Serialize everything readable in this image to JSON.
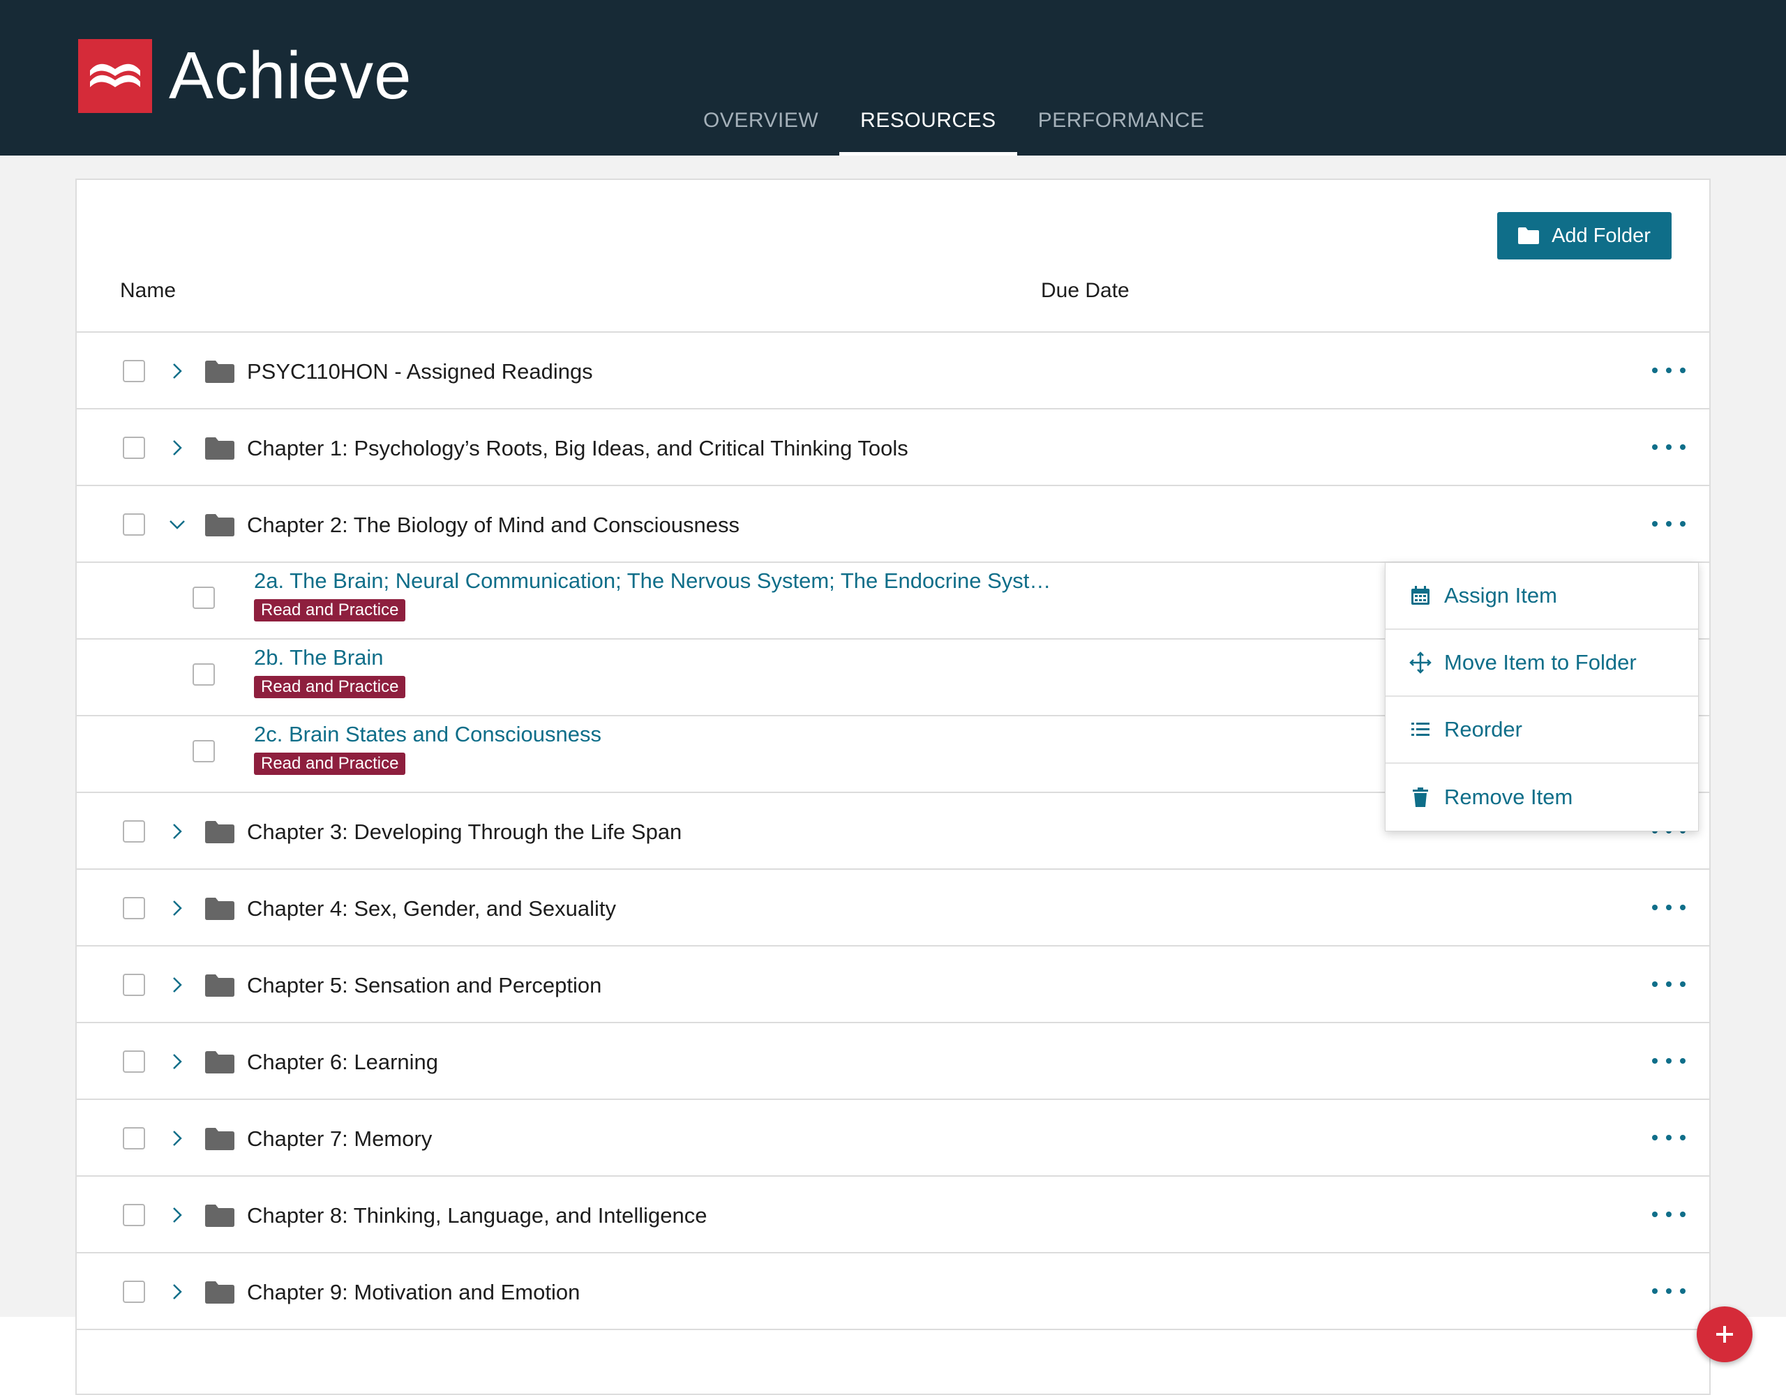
{
  "brand": {
    "name": "Achieve",
    "logo_color": "#d52b39"
  },
  "nav": {
    "tabs": [
      {
        "label": "OVERVIEW",
        "active": false
      },
      {
        "label": "RESOURCES",
        "active": true
      },
      {
        "label": "PERFORMANCE",
        "active": false
      }
    ]
  },
  "toolbar": {
    "add_folder_label": "Add Folder",
    "add_folder_icon": "folder-icon"
  },
  "table": {
    "columns": [
      "Name",
      "Due Date"
    ],
    "rows": [
      {
        "type": "folder",
        "title": "PSYC110HON - Assigned Readings",
        "expanded": false
      },
      {
        "type": "folder",
        "title": "Chapter 1: Psychology’s Roots, Big Ideas, and Critical Thinking Tools",
        "expanded": false
      },
      {
        "type": "folder",
        "title": "Chapter 2: The Biology of Mind and Consciousness",
        "expanded": true
      },
      {
        "type": "item",
        "title": "2a. The Brain; Neural Communication; The Nervous System; The Endocrine Syst…",
        "badge": "Read and Practice"
      },
      {
        "type": "item",
        "title": "2b. The Brain",
        "badge": "Read and Practice"
      },
      {
        "type": "item",
        "title": "2c. Brain States and Consciousness",
        "badge": "Read and Practice"
      },
      {
        "type": "folder",
        "title": "Chapter 3: Developing Through the Life Span",
        "expanded": false
      },
      {
        "type": "folder",
        "title": "Chapter 4: Sex, Gender, and Sexuality",
        "expanded": false
      },
      {
        "type": "folder",
        "title": "Chapter 5: Sensation and Perception",
        "expanded": false
      },
      {
        "type": "folder",
        "title": "Chapter 6: Learning",
        "expanded": false
      },
      {
        "type": "folder",
        "title": "Chapter 7: Memory",
        "expanded": false
      },
      {
        "type": "folder",
        "title": "Chapter 8: Thinking, Language, and Intelligence",
        "expanded": false
      },
      {
        "type": "folder",
        "title": "Chapter 9: Motivation and Emotion",
        "expanded": false
      }
    ]
  },
  "context_menu": {
    "items": [
      {
        "label": "Assign Item",
        "icon": "calendar-icon"
      },
      {
        "label": "Move Item to Folder",
        "icon": "move-icon"
      },
      {
        "label": "Reorder",
        "icon": "list-icon"
      },
      {
        "label": "Remove Item",
        "icon": "trash-icon"
      }
    ]
  },
  "colors": {
    "header_bg": "#172a36",
    "accent": "#0f6e89",
    "badge": "#8e1f3e",
    "fab": "#d52b39"
  },
  "fab": {
    "icon": "plus-icon"
  }
}
